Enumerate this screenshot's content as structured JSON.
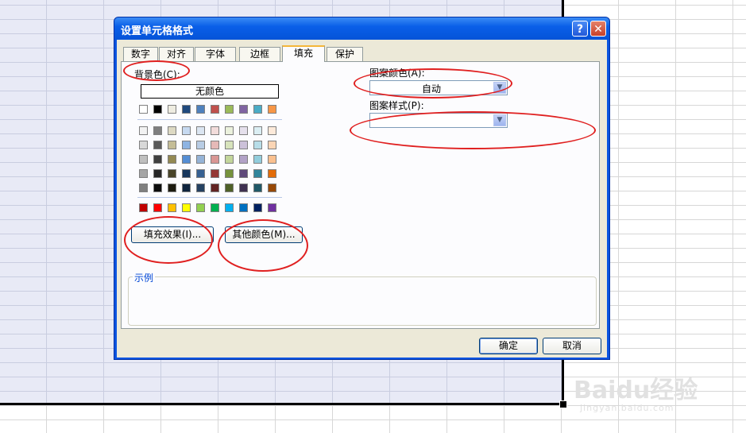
{
  "dialog": {
    "title": "设置单元格格式",
    "help_glyph": "?",
    "close_glyph": "✕",
    "tabs": [
      {
        "label": "数字"
      },
      {
        "label": "对齐"
      },
      {
        "label": "字体"
      },
      {
        "label": "边框"
      },
      {
        "label": "填充",
        "active": true
      },
      {
        "label": "保护"
      }
    ],
    "background_label": "背景色(C):",
    "no_color_label": "无颜色",
    "fill_effects_label": "填充效果(I)...",
    "more_colors_label": "其他颜色(M)...",
    "pattern_color_label": "图案颜色(A):",
    "pattern_color_value": "自动",
    "pattern_style_label": "图案样式(P):",
    "pattern_style_value": "",
    "sample_label": "示例",
    "ok_label": "确定",
    "cancel_label": "取消"
  },
  "palette": {
    "theme_top": [
      "#ffffff",
      "#000000",
      "#eeece1",
      "#1f497d",
      "#4f81bd",
      "#c0504d",
      "#9bbb59",
      "#8064a2",
      "#4bacc6",
      "#f79646"
    ],
    "theme_shades": [
      [
        "#f2f2f2",
        "#7f7f7f",
        "#ddd9c3",
        "#c6d9f0",
        "#dbe5f1",
        "#f2dcdb",
        "#ebf1dd",
        "#e5e0ec",
        "#dbeef3",
        "#fdeada"
      ],
      [
        "#d8d8d8",
        "#595959",
        "#c4bd97",
        "#8db3e2",
        "#b8cce4",
        "#e5b9b7",
        "#d7e3bc",
        "#ccc1d9",
        "#b7dde8",
        "#fbd5b5"
      ],
      [
        "#bfbfbf",
        "#3f3f3f",
        "#938953",
        "#548dd4",
        "#95b3d7",
        "#d99694",
        "#c3d69b",
        "#b2a2c7",
        "#92cddc",
        "#fac08f"
      ],
      [
        "#a5a5a5",
        "#262626",
        "#494429",
        "#17365d",
        "#366092",
        "#953734",
        "#76923c",
        "#5f497a",
        "#31859b",
        "#e36c09"
      ],
      [
        "#7f7f7f",
        "#0c0c0c",
        "#1d1b10",
        "#0f243e",
        "#244061",
        "#632423",
        "#4f6128",
        "#3f3151",
        "#205867",
        "#974806"
      ]
    ],
    "standard": [
      "#c00000",
      "#ff0000",
      "#ffc000",
      "#ffff00",
      "#92d050",
      "#00b050",
      "#00b0f0",
      "#0070c0",
      "#002060",
      "#7030a0"
    ]
  },
  "watermark": {
    "brand": "Baidu经验",
    "url": "jingyan.baidu.com"
  },
  "colors": {
    "annotation": "#e02020",
    "titlebar": "#0a5fe8",
    "client_bg": "#ece9d8"
  }
}
